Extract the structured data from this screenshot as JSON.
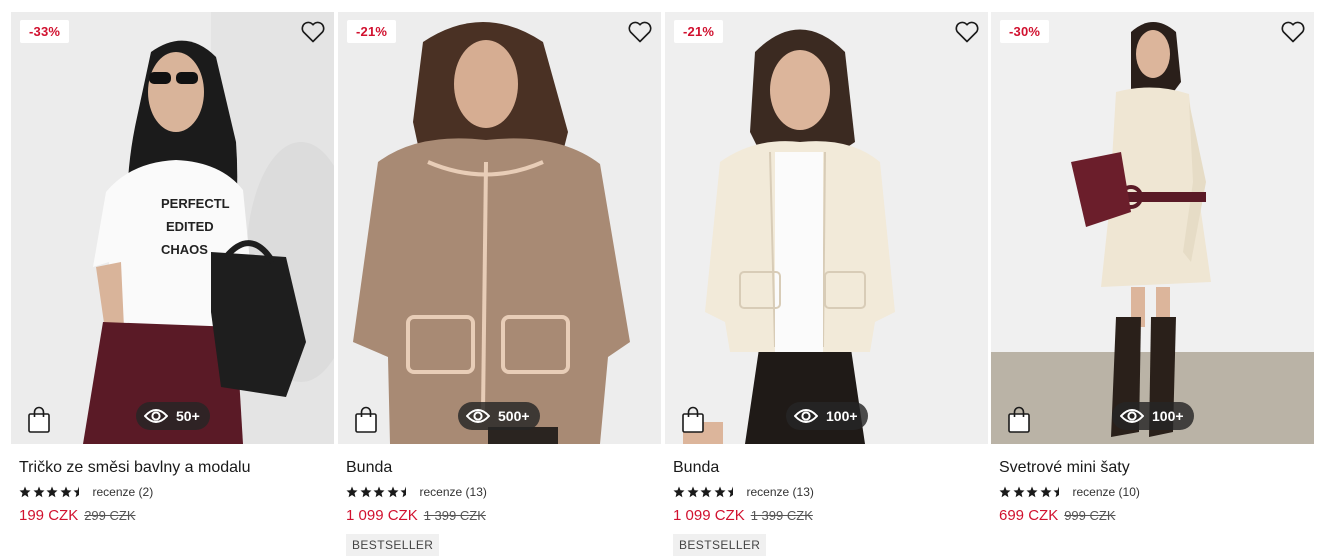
{
  "products": [
    {
      "discount": "-33%",
      "views": "50+",
      "name": "Tričko ze směsi bavlny a modalu",
      "reviews": "recenze (2)",
      "price": "199 CZK",
      "old_price": "299 CZK",
      "badge": "",
      "rating": 4.5,
      "shirt_print": [
        "PERFECTL",
        "EDITED",
        "CHAOS"
      ]
    },
    {
      "discount": "-21%",
      "views": "500+",
      "name": "Bunda",
      "reviews": "recenze (13)",
      "price": "1 099 CZK",
      "old_price": "1 399 CZK",
      "badge": "BESTSELLER",
      "rating": 4.5
    },
    {
      "discount": "-21%",
      "views": "100+",
      "name": "Bunda",
      "reviews": "recenze (13)",
      "price": "1 099 CZK",
      "old_price": "1 399 CZK",
      "badge": "BESTSELLER",
      "rating": 4.5
    },
    {
      "discount": "-30%",
      "views": "100+",
      "name": "Svetrové mini šaty",
      "reviews": "recenze (10)",
      "price": "699 CZK",
      "old_price": "999 CZK",
      "badge": "",
      "rating": 4.5
    }
  ],
  "icons": {
    "wishlist": "heart-icon",
    "cart": "shopping-bag-icon",
    "views": "eye-icon",
    "rating": "star-icon"
  },
  "colors": {
    "discount": "#d1112f",
    "price": "#d1112f",
    "views_pill": "#262626"
  }
}
